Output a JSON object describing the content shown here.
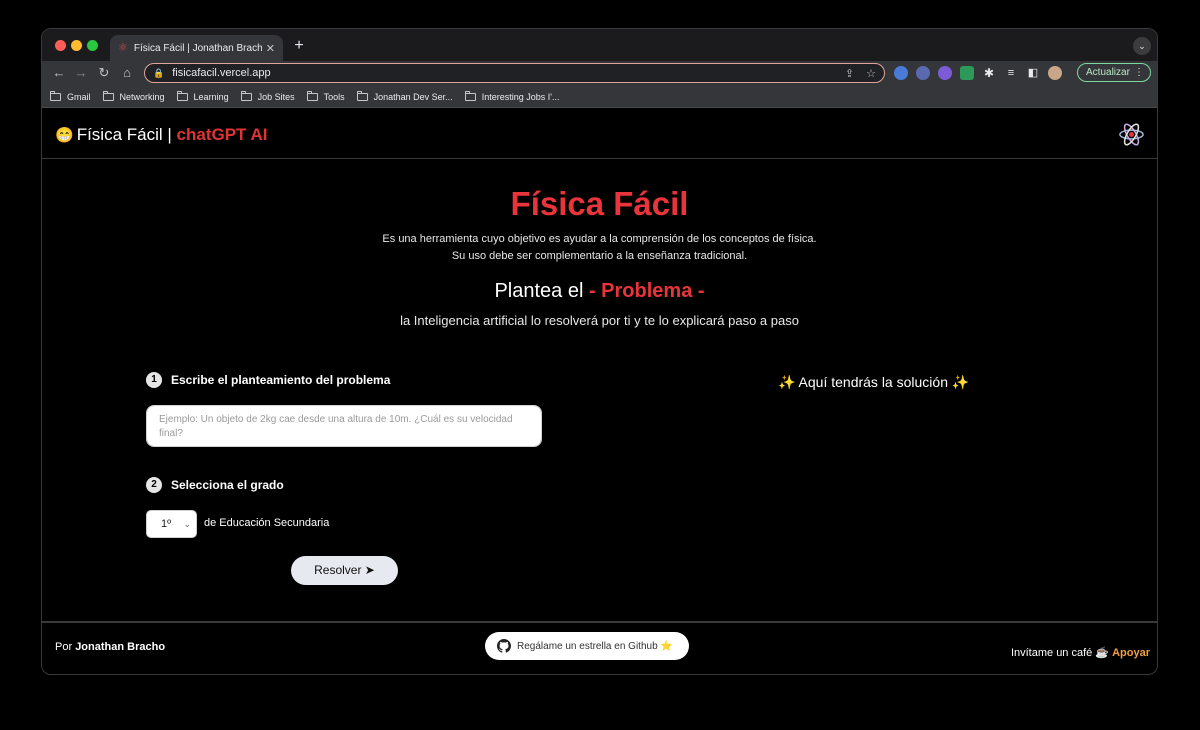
{
  "browser": {
    "tab": {
      "title": "Física Fácil | Jonathan Bracho",
      "close": "✕"
    },
    "new_tab": "+",
    "tabs_dropdown": "⌄",
    "nav": {
      "back": "←",
      "forward": "→",
      "reload": "↻",
      "home": "⌂"
    },
    "url": "fisicafacil.vercel.app",
    "update_button": "Actualizar",
    "menu": "⋮",
    "bookmarks": [
      "Gmail",
      "Networking",
      "Learning",
      "Job Sites",
      "Tools",
      "Jonathan Dev Ser...",
      "Interesting Jobs I'..."
    ],
    "accent_color": "#e0a39a"
  },
  "site": {
    "logo": {
      "emoji": "😁",
      "name": "Física Fácil",
      "separator": " | ",
      "accent": "chatGPT AI"
    },
    "accent_color": "#e8343a",
    "hero": {
      "title": "Física Fácil",
      "desc_line1": "Es una herramienta cuyo objetivo es ayudar a la comprensión de los conceptos de física.",
      "desc_line2": "Su uso debe ser complementario a la enseñanza tradicional."
    },
    "subtitle": {
      "prefix": "Plantea el ",
      "accent": "- Problema -"
    },
    "tagline": "la Inteligencia artificial lo resolverá por ti y te lo explicará paso a paso",
    "step1": {
      "number": "1",
      "label": "Escribe el planteamiento del problema"
    },
    "problem_input": {
      "value": "",
      "placeholder": "Ejemplo: Un objeto de 2kg cae desde una altura de 10m. ¿Cuál es su velocidad final?"
    },
    "step2": {
      "number": "2",
      "label": "Selecciona el grado"
    },
    "grade": {
      "selected": "1º",
      "suffix": "de Educación Secundaria"
    },
    "resolve_button": "Resolver ➤",
    "solution_heading": "✨ Aquí tendrás la solución ✨",
    "footer": {
      "by_prefix": "Por ",
      "author": "Jonathan Bracho",
      "github_button": "Regálame un estrella en Github ⭐",
      "coffee_text": "Invítame un café ☕",
      "support_link": "Apoyar"
    }
  }
}
